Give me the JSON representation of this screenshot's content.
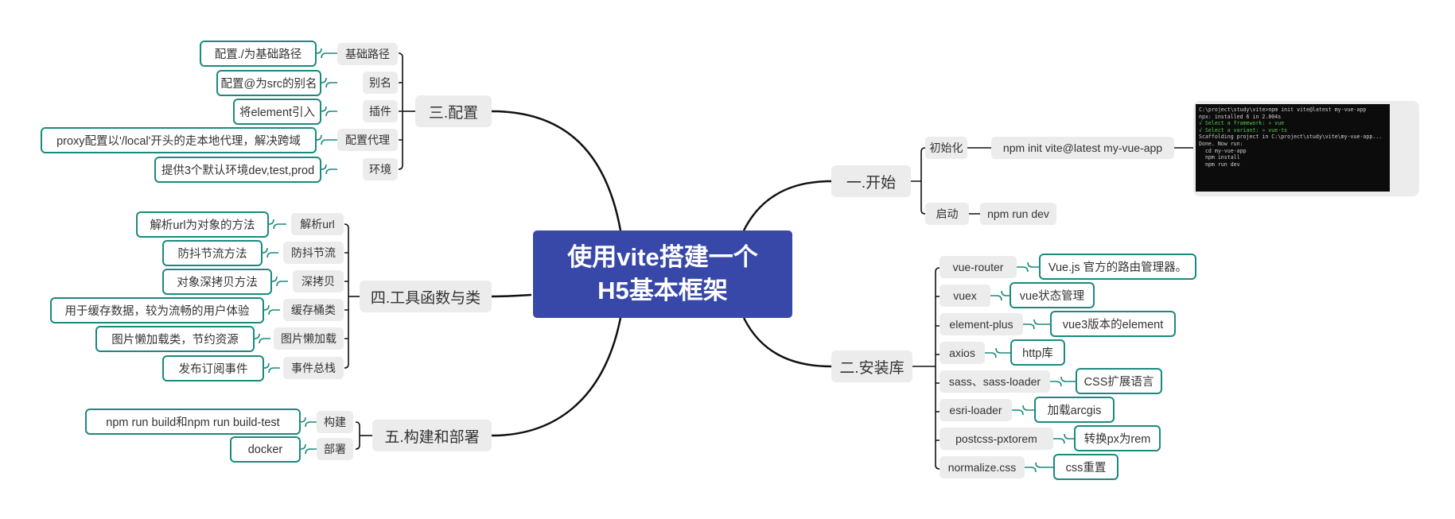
{
  "center": {
    "line1": "使用vite搭建一个",
    "line2": "H5基本框架"
  },
  "colors": {
    "center": "#3848a8",
    "leaf_border": "#1a8a7e",
    "branch_bg": "#ececec",
    "line": "#111111"
  },
  "branches": {
    "config": {
      "label": "三.配置",
      "items": [
        {
          "label": "基础路径",
          "leaf": "配置./为基础路径"
        },
        {
          "label": "别名",
          "leaf": "配置@为src的别名"
        },
        {
          "label": "插件",
          "leaf": "将element引入"
        },
        {
          "label": "配置代理",
          "leaf": "proxy配置以'/local'开头的走本地代理，解决跨域"
        },
        {
          "label": "环境",
          "leaf": "提供3个默认环境dev,test,prod"
        }
      ]
    },
    "utils": {
      "label": "四.工具函数与类",
      "items": [
        {
          "label": "解析url",
          "leaf": "解析url为对象的方法"
        },
        {
          "label": "防抖节流",
          "leaf": "防抖节流方法"
        },
        {
          "label": "深拷贝",
          "leaf": "对象深拷贝方法"
        },
        {
          "label": "缓存桶类",
          "leaf": "用于缓存数据，较为流畅的用户体验"
        },
        {
          "label": "图片懒加载",
          "leaf": "图片懒加载类，节约资源"
        },
        {
          "label": "事件总栈",
          "leaf": "发布订阅事件"
        }
      ]
    },
    "build": {
      "label": "五.构建和部署",
      "items": [
        {
          "label": "构建",
          "leaf": "npm run build和npm run build-test"
        },
        {
          "label": "部署",
          "leaf": "docker"
        }
      ]
    },
    "start": {
      "label": "一.开始",
      "items": [
        {
          "label": "初始化",
          "value": "npm init vite@latest my-vue-app"
        },
        {
          "label": "启动",
          "value": "npm run dev"
        }
      ],
      "terminal": [
        "C:\\project\\study\\vite>npm init vite@latest my-vue-app",
        "npx: installed 6 in 2.004s",
        "√ Select a framework: » vue",
        "√ Select a variant: » vue-ts",
        "",
        "Scaffolding project in C:\\project\\study\\vite\\my-vue-app...",
        "",
        "Done. Now run:",
        "",
        "  cd my-vue-app",
        "  npm install",
        "  npm run dev"
      ]
    },
    "libs": {
      "label": "二.安装库",
      "items": [
        {
          "label": "vue-router",
          "leaf": "Vue.js 官方的路由管理器。"
        },
        {
          "label": "vuex",
          "leaf": "vue状态管理"
        },
        {
          "label": "element-plus",
          "leaf": "vue3版本的element"
        },
        {
          "label": "axios",
          "leaf": "http库"
        },
        {
          "label": "sass、sass-loader",
          "leaf": "CSS扩展语言"
        },
        {
          "label": "esri-loader",
          "leaf": "加载arcgis"
        },
        {
          "label": "postcss-pxtorem",
          "leaf": "转换px为rem"
        },
        {
          "label": "normalize.css",
          "leaf": "css重置"
        }
      ]
    }
  }
}
